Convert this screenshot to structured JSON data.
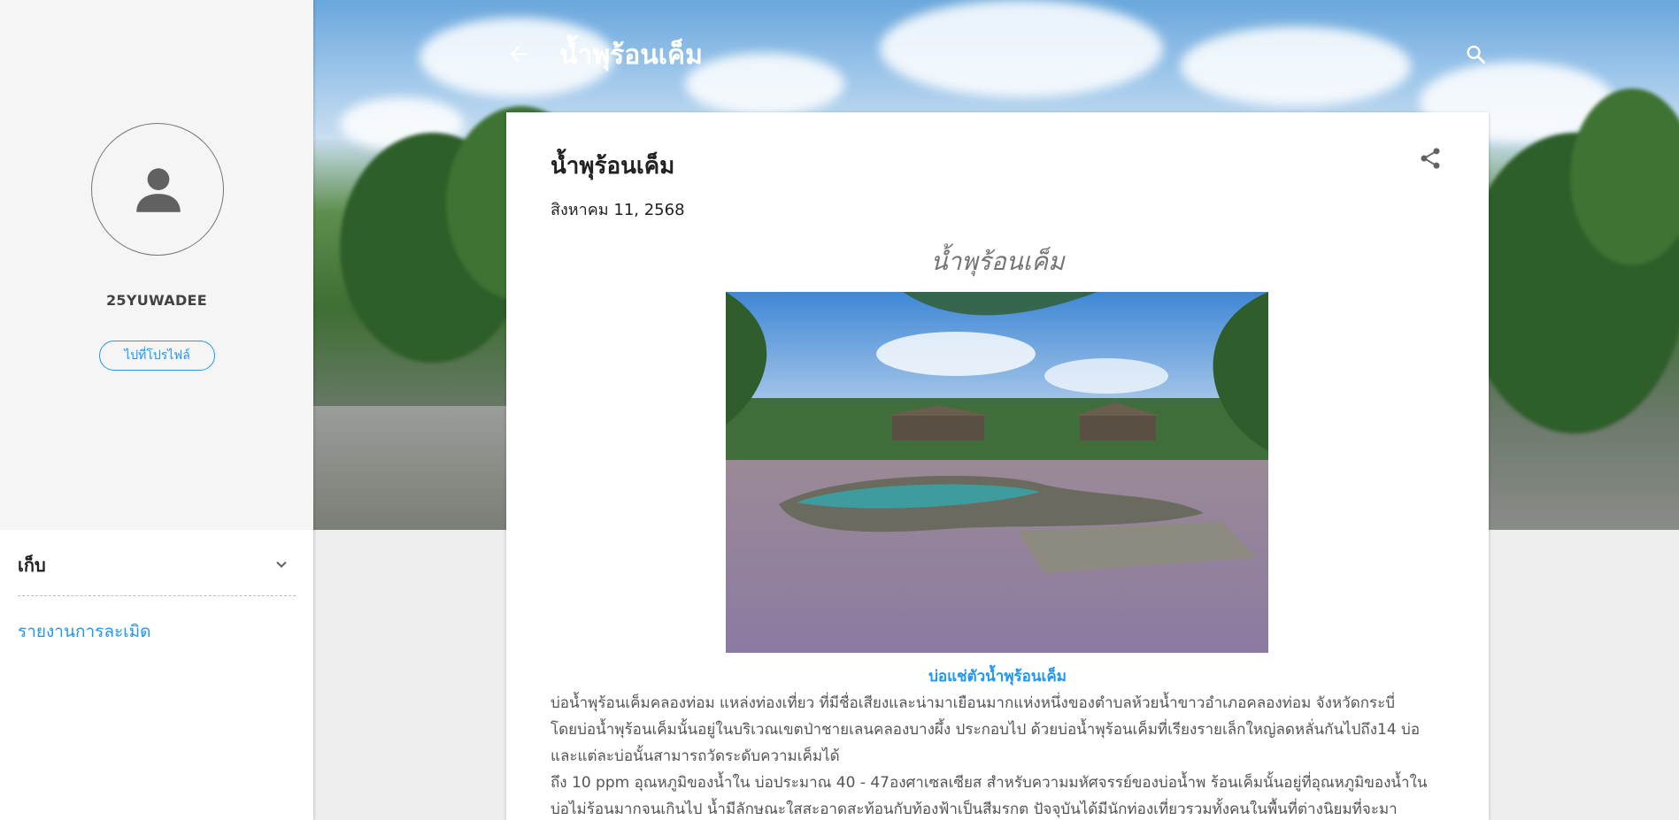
{
  "sidebar": {
    "profile_name": "25YUWADEE",
    "profile_button": "ไปที่โปรไฟล์",
    "archive_title": "เก็บ",
    "report_link": "รายงานการละเมิด"
  },
  "header": {
    "blog_title": "น้ำพุร้อนเค็ม"
  },
  "post": {
    "title": "น้ำพุร้อนเค็ม",
    "date": "สิงหาคม 11, 2568",
    "heading": "น้ำพุร้อนเค็ม",
    "image_caption": "บ่อแช่ตัวน้ำพุร้อนเค็ม",
    "body_lines": [
      "บ่อน้ำพุร้อนเค็มคลองท่อม แหล่งท่องเที่ยว ที่มีชื่อเสียงและน่ามาเยือนมากแห่งหนึ่งของตำบลห้วยน้ำขาวอำเภอคลองท่อม จังหวัดกระบี่",
      "โดยบ่อน้ำพุร้อนเค็มนั้นอยู่ในบริเวณเขตป่าชายเลนคลองบางผึ้ง ประกอบไป ด้วยบ่อน้ำพุร้อนเค็มที่เรียงรายเล็กใหญ่ลดหลั่นกันไปถึง14 บ่อ",
      "และแต่ละบ่อนั้นสามารถวัดระดับความเค็มได้",
      "ถึง 10 ppm อุณหภูมิของน้ำใน บ่อประมาณ 40 - 47องศาเซลเซียส สำหรับความมหัศจรรย์ของบ่อน้ำพ ร้อนเค็มนั้นอยู่ที่อุณหภูมิของน้ำใน",
      "บ่อไม่ร้อนมากจนเกินไป น้ำมีลักษณะใสสะอาดสะท้อนกับท้องฟ้าเป็นสีมรกต ปัจจุบันได้มีนักท่องเที่ยวรวมทั้งคนในพื้นที่ต่างนิยมที่จะมา"
    ]
  },
  "colors": {
    "accent": "#2196f3",
    "sidebar_bg": "#f5f5f5",
    "page_bg": "#eeeeee"
  },
  "icons": {
    "avatar": "person-icon",
    "archive_toggle": "chevron-down-icon",
    "back": "arrow-back-icon",
    "search": "search-icon",
    "share": "share-icon"
  }
}
